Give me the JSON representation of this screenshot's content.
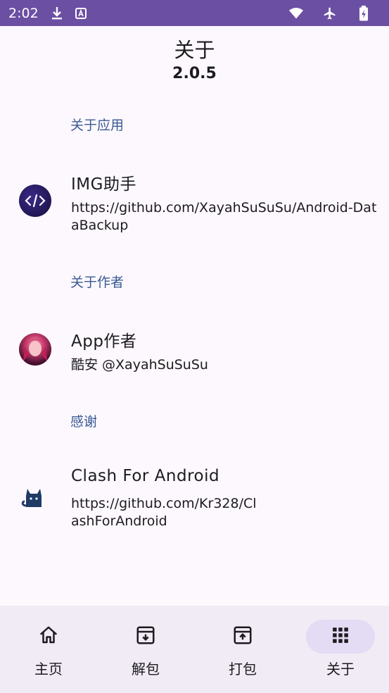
{
  "status_bar": {
    "time": "2:02"
  },
  "header": {
    "title": "关于",
    "version": "2.0.5"
  },
  "sections": [
    {
      "label": "关于应用"
    },
    {
      "label": "关于作者"
    },
    {
      "label": "感谢"
    }
  ],
  "items": [
    {
      "title": "IMG助手",
      "subtitle": "https://github.com/XayahSuSuSu/Android-DataBackup",
      "icon": "code-icon"
    },
    {
      "title": "App作者",
      "subtitle": "酷安 @XayahSuSuSu",
      "icon": "author-avatar"
    },
    {
      "title": "Clash For Android",
      "subtitle": "https://github.com/Kr328/ClashForAndroid",
      "icon": "cat-icon"
    }
  ],
  "nav": {
    "items": [
      {
        "label": "主页",
        "icon": "home-icon"
      },
      {
        "label": "解包",
        "icon": "archive-down-icon"
      },
      {
        "label": "打包",
        "icon": "archive-up-icon"
      },
      {
        "label": "关于",
        "icon": "apps-grid-icon"
      }
    ],
    "active_index": 3
  },
  "colors": {
    "status_bar": "#6b4fa3",
    "section_label": "#3a5a94",
    "background": "#fdf8fd",
    "nav_bg": "#f1ebf5",
    "active_pill": "#e4dbf4"
  }
}
